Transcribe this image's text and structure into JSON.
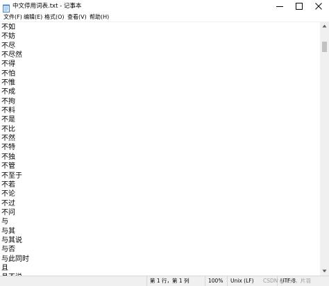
{
  "window": {
    "title": "中文停用词表.txt - 记事本"
  },
  "menu": {
    "file": "文件(F)",
    "edit": "编辑(E)",
    "format": "格式(O)",
    "view": "查看(V)",
    "help": "帮助(H)"
  },
  "editor": {
    "lines": [
      "不如",
      "不妨",
      "不尽",
      "不尽然",
      "不得",
      "不怕",
      "不惟",
      "不成",
      "不拘",
      "不料",
      "不是",
      "不比",
      "不然",
      "不特",
      "不独",
      "不管",
      "不至于",
      "不若",
      "不论",
      "不过",
      "不问",
      "与",
      "与其",
      "与其说",
      "与否",
      "与此同时",
      "且",
      "且不说"
    ]
  },
  "statusbar": {
    "position": "第 1 行，第 1 列",
    "zoom": "100%",
    "line_ending": "Unix (LF)",
    "encoding": "UTF-8",
    "watermark": "CSDN @未光，片羽"
  },
  "icons": {
    "app": "notepad-icon",
    "minimize": "minimize-icon",
    "maximize": "maximize-icon",
    "close": "close-icon"
  },
  "colors": {
    "background": "#ffffff",
    "chrome": "#f0f0f0",
    "scroll_thumb": "#c1c1c1",
    "text": "#000000"
  }
}
